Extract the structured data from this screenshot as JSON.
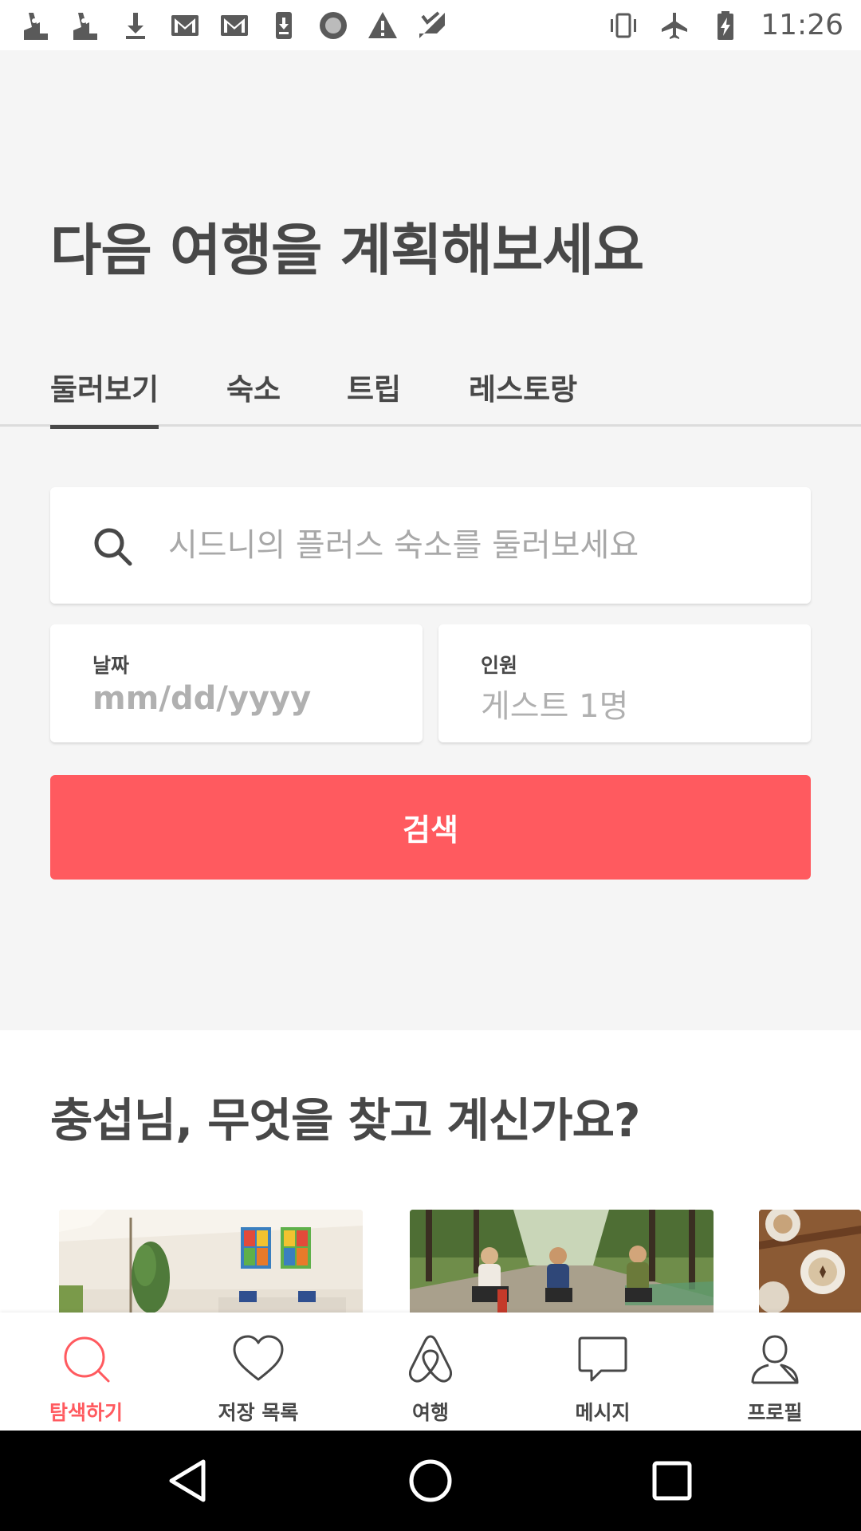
{
  "status_bar": {
    "time": "11:26",
    "notification_icons": [
      "rabbit-icon",
      "rabbit-icon",
      "download-icon",
      "gmail-icon",
      "gmail-icon",
      "phone-download-icon",
      "record-icon",
      "warning-icon",
      "signal-check-icon"
    ],
    "system_icons": [
      "vibrate-icon",
      "airplane-icon",
      "battery-charging-icon"
    ]
  },
  "hero": {
    "title": "다음 여행을 계획해보세요",
    "tabs": [
      {
        "label": "둘러보기",
        "active": true
      },
      {
        "label": "숙소",
        "active": false
      },
      {
        "label": "트립",
        "active": false
      },
      {
        "label": "레스토랑",
        "active": false
      }
    ],
    "search": {
      "placeholder": "시드니의 플러스 숙소를 둘러보세요"
    },
    "date_field": {
      "label": "날짜",
      "placeholder": "mm/dd/yyyy"
    },
    "guests_field": {
      "label": "인원",
      "value": "게스트 1명"
    },
    "search_button_label": "검색"
  },
  "section": {
    "title": "충섭님, 무엇을 찾고 계신가요?",
    "cards": [
      "living-room-photo",
      "cycling-photo",
      "food-photo"
    ]
  },
  "bottom_nav": {
    "items": [
      {
        "label": "탐색하기",
        "icon": "search-icon",
        "active": true
      },
      {
        "label": "저장 목록",
        "icon": "heart-icon",
        "active": false
      },
      {
        "label": "여행",
        "icon": "airbnb-logo-icon",
        "active": false
      },
      {
        "label": "메시지",
        "icon": "message-icon",
        "active": false
      },
      {
        "label": "프로필",
        "icon": "profile-icon",
        "active": false
      }
    ]
  },
  "colors": {
    "accent": "#ff5a5f",
    "text": "#484848",
    "hero_background": "#f5f5f5"
  }
}
